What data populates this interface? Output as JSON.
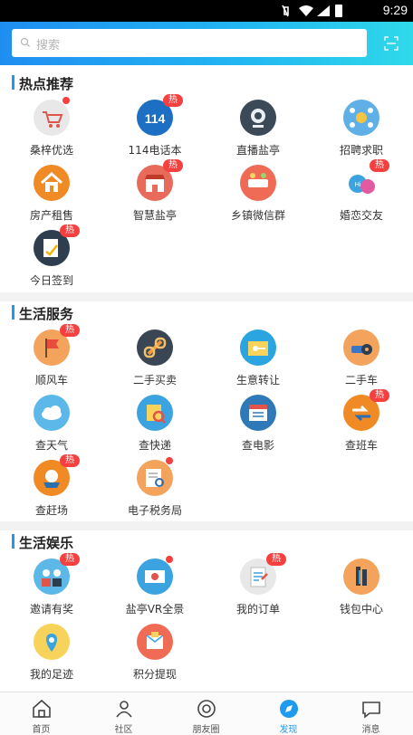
{
  "status_bar": {
    "time": "9:29"
  },
  "search": {
    "placeholder": "搜索"
  },
  "sections": [
    {
      "title": "热点推荐",
      "items": [
        {
          "label": "桑梓优选",
          "icon": "shopping-cart-icon",
          "color": "#e8e8e8",
          "badge": "",
          "dot": true
        },
        {
          "label": "114电话本",
          "icon": "phonebook-114-icon",
          "color": "#1c6fc2",
          "badge": "热",
          "dot": false
        },
        {
          "label": "直播盐亭",
          "icon": "webcam-icon",
          "color": "#3c4a58",
          "badge": "",
          "dot": false
        },
        {
          "label": "招聘求职",
          "icon": "recruitment-network-icon",
          "color": "#5fb0e6",
          "badge": "",
          "dot": false
        },
        {
          "label": "房产租售",
          "icon": "house-icon",
          "color": "#f08a24",
          "badge": "",
          "dot": false
        },
        {
          "label": "智慧盐亭",
          "icon": "smart-city-shop-icon",
          "color": "#e86a5a",
          "badge": "热",
          "dot": false
        },
        {
          "label": "乡镇微信群",
          "icon": "wechat-group-icon",
          "color": "#ef6b55",
          "badge": "",
          "dot": false
        },
        {
          "label": "婚恋交友",
          "icon": "chat-bubbles-love-icon",
          "color": "#ffffff",
          "badge": "热",
          "dot": false
        },
        {
          "label": "今日签到",
          "icon": "check-in-icon",
          "color": "#2e3e4e",
          "badge": "热",
          "dot": false
        }
      ]
    },
    {
      "title": "生活服务",
      "items": [
        {
          "label": "顺风车",
          "icon": "flag-icon",
          "color": "#f3a35b",
          "badge": "热",
          "dot": false
        },
        {
          "label": "二手买卖",
          "icon": "chain-link-icon",
          "color": "#3a4654",
          "badge": "",
          "dot": false
        },
        {
          "label": "生意转让",
          "icon": "folder-key-icon",
          "color": "#2aa5e0",
          "badge": "",
          "dot": false
        },
        {
          "label": "二手车",
          "icon": "car-gear-icon",
          "color": "#f3a35b",
          "badge": "",
          "dot": false
        },
        {
          "label": "查天气",
          "icon": "weather-cloud-icon",
          "color": "#5db8ea",
          "badge": "",
          "dot": false
        },
        {
          "label": "查快递",
          "icon": "parcel-search-icon",
          "color": "#3ba3df",
          "badge": "",
          "dot": false
        },
        {
          "label": "查电影",
          "icon": "movie-calendar-icon",
          "color": "#2f79b8",
          "badge": "",
          "dot": false
        },
        {
          "label": "查班车",
          "icon": "bus-arrows-icon",
          "color": "#f08a24",
          "badge": "热",
          "dot": false
        },
        {
          "label": "查赶场",
          "icon": "market-basket-icon",
          "color": "#f08a24",
          "badge": "热",
          "dot": false
        },
        {
          "label": "电子税务局",
          "icon": "tax-document-search-icon",
          "color": "#f3a35b",
          "badge": "",
          "dot": true
        }
      ]
    },
    {
      "title": "生活娱乐",
      "items": [
        {
          "label": "邀请有奖",
          "icon": "invite-people-icon",
          "color": "#5db8ea",
          "badge": "热",
          "dot": false
        },
        {
          "label": "盐亭VR全景",
          "icon": "vr-panorama-icon",
          "color": "#3ba3df",
          "badge": "",
          "dot": true
        },
        {
          "label": "我的订单",
          "icon": "order-clipboard-icon",
          "color": "#e8e8e8",
          "badge": "热",
          "dot": false
        },
        {
          "label": "钱包中心",
          "icon": "wallet-icon",
          "color": "#f3a35b",
          "badge": "",
          "dot": false
        },
        {
          "label": "我的足迹",
          "icon": "location-pin-icon",
          "color": "#f7d35c",
          "badge": "",
          "dot": false
        },
        {
          "label": "积分提现",
          "icon": "points-withdraw-icon",
          "color": "#ef6b55",
          "badge": "",
          "dot": false
        }
      ]
    }
  ],
  "tabs": [
    {
      "label": "首页",
      "icon": "home-icon",
      "active": false
    },
    {
      "label": "社区",
      "icon": "community-icon",
      "active": false
    },
    {
      "label": "朋友圈",
      "icon": "moments-icon",
      "active": false
    },
    {
      "label": "发现",
      "icon": "discover-icon",
      "active": true
    },
    {
      "label": "消息",
      "icon": "message-icon",
      "active": false
    }
  ],
  "colors": {
    "accent": "#1e9bf0",
    "badge": "#f5403f",
    "header_start": "#1f8ef1",
    "header_end": "#2fd9e9"
  }
}
